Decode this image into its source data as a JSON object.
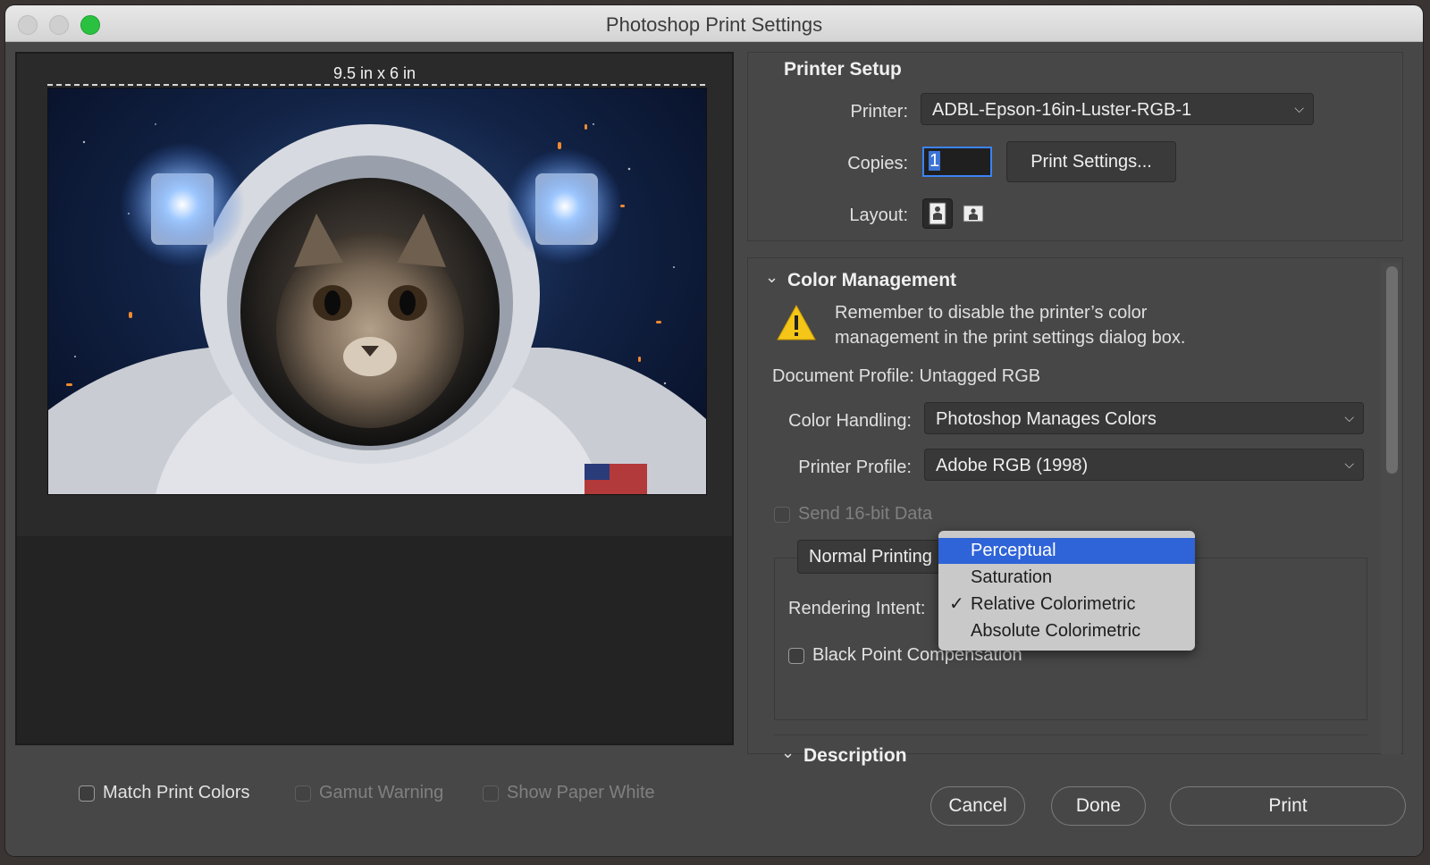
{
  "window": {
    "title": "Photoshop Print Settings"
  },
  "preview": {
    "size_label": "9.5 in x 6 in"
  },
  "bottom_options": {
    "match_print_colors": "Match Print Colors",
    "gamut_warning": "Gamut Warning",
    "show_paper_white": "Show Paper White"
  },
  "printer_setup": {
    "title": "Printer Setup",
    "printer_label": "Printer:",
    "printer_value": "ADBL-Epson-16in-Luster-RGB-1",
    "copies_label": "Copies:",
    "copies_value": "1",
    "print_settings_button": "Print Settings...",
    "layout_label": "Layout:"
  },
  "color_management": {
    "title": "Color Management",
    "warning_line1": "Remember to disable the printer’s color",
    "warning_line2": "management in the print settings dialog box.",
    "document_profile": "Document Profile: Untagged RGB",
    "color_handling_label": "Color Handling:",
    "color_handling_value": "Photoshop Manages Colors",
    "printer_profile_label": "Printer Profile:",
    "printer_profile_value": "Adobe RGB (1998)",
    "send_16bit": "Send 16-bit Data",
    "normal_printing": "Normal Printing",
    "rendering_intent_label": "Rendering Intent:",
    "black_point": "Black Point Compensation"
  },
  "rendering_menu": {
    "items": [
      {
        "label": "Perceptual",
        "highlighted": true
      },
      {
        "label": "Saturation"
      },
      {
        "label": "Relative Colorimetric",
        "checked": "✓"
      },
      {
        "label": "Absolute Colorimetric"
      }
    ]
  },
  "description": {
    "title": "Description"
  },
  "buttons": {
    "cancel": "Cancel",
    "done": "Done",
    "print": "Print"
  },
  "colors": {
    "accent": "#2f63d8",
    "window_bg": "#474747"
  }
}
